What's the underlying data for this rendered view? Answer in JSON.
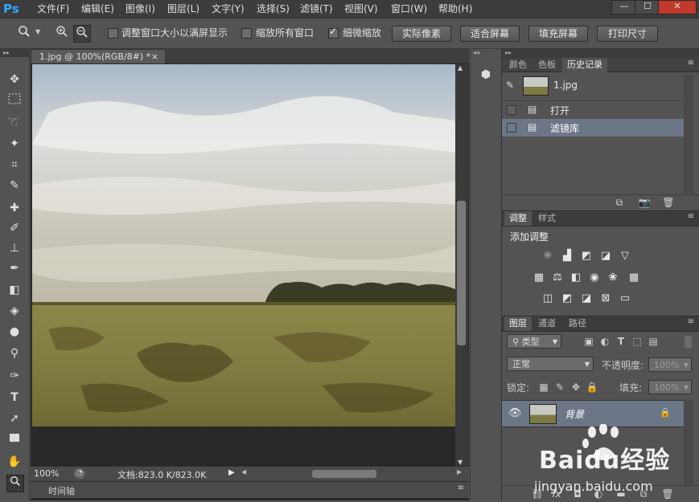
{
  "app": {
    "logo": "Ps"
  },
  "menu": [
    "文件(F)",
    "编辑(E)",
    "图像(I)",
    "图层(L)",
    "文字(Y)",
    "选择(S)",
    "滤镜(T)",
    "视图(V)",
    "窗口(W)",
    "帮助(H)"
  ],
  "window_controls": {
    "minimize": "—",
    "maximize": "☐",
    "close": "✕"
  },
  "options": {
    "resize_windows_label": "调整窗口大小以满屏显示",
    "zoom_all_label": "缩放所有窗口",
    "scrubby_label": "细微缩放",
    "actual_pixels": "实际像素",
    "fit_screen": "适合屏幕",
    "fill_screen": "填充屏幕",
    "print_size": "打印尺寸"
  },
  "document": {
    "tab_title": "1.jpg @ 100%(RGB/8#) *",
    "tab_close": "×",
    "zoom": "100%",
    "doc_size": "文档:823.0 K/823.0K",
    "timeline_label": "时间轴"
  },
  "history_panel": {
    "tabs": [
      "颜色",
      "色板",
      "历史记录"
    ],
    "snapshot_name": "1.jpg",
    "items": [
      "打开",
      "滤镜库"
    ]
  },
  "adjust_panel": {
    "tabs": [
      "调整",
      "样式"
    ],
    "heading": "添加调整"
  },
  "layers_panel": {
    "tabs": [
      "图层",
      "通道",
      "路径"
    ],
    "filter_kind": "类型",
    "blend_mode": "正常",
    "opacity_label": "不透明度:",
    "opacity_value": "100%",
    "lock_label": "锁定:",
    "fill_label": "填充:",
    "fill_value": "100%",
    "layer_name": "背景"
  },
  "watermark": {
    "brand": "Baidu经验",
    "url": "jingyan.baidu.com"
  }
}
